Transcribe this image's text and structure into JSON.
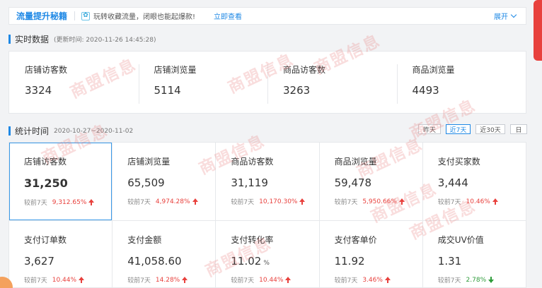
{
  "banner": {
    "title": "流量提升秘籍",
    "icon": "gift-icon",
    "text": "玩转收藏流量，闭眼也能起爆款!",
    "link": "立即查看",
    "expand": "展开"
  },
  "realtime": {
    "title": "实时数据",
    "updated": "(更新时间: 2020-11-26 14:45:28)",
    "items": [
      {
        "label": "店铺访客数",
        "value": "3324"
      },
      {
        "label": "店铺浏览量",
        "value": "5114"
      },
      {
        "label": "商品访客数",
        "value": "3263"
      },
      {
        "label": "商品浏览量",
        "value": "4493"
      }
    ]
  },
  "stats": {
    "title": "统计时间",
    "range": "2020-10-27~2020-11-02",
    "buttons": [
      "昨天",
      "近7天",
      "近30天",
      "日"
    ],
    "active_button": "近7天",
    "cards": [
      {
        "label": "店铺访客数",
        "value": "31,250",
        "unit": "",
        "cmp_label": "较前7天",
        "cmp_value": "9,312.65%",
        "trend": "up"
      },
      {
        "label": "店铺浏览量",
        "value": "65,509",
        "unit": "",
        "cmp_label": "较前7天",
        "cmp_value": "4,974.28%",
        "trend": "up"
      },
      {
        "label": "商品访客数",
        "value": "31,119",
        "unit": "",
        "cmp_label": "较前7天",
        "cmp_value": "10,170.30%",
        "trend": "up"
      },
      {
        "label": "商品浏览量",
        "value": "59,478",
        "unit": "",
        "cmp_label": "较前7天",
        "cmp_value": "5,950.66%",
        "trend": "up"
      },
      {
        "label": "支付买家数",
        "value": "3,444",
        "unit": "",
        "cmp_label": "较前7天",
        "cmp_value": "10.46%",
        "trend": "up"
      },
      {
        "label": "支付订单数",
        "value": "3,627",
        "unit": "",
        "cmp_label": "较前7天",
        "cmp_value": "10.44%",
        "trend": "up"
      },
      {
        "label": "支付金额",
        "value": "41,058.60",
        "unit": "",
        "cmp_label": "较前7天",
        "cmp_value": "14.28%",
        "trend": "up"
      },
      {
        "label": "支付转化率",
        "value": "11.02",
        "unit": "%",
        "cmp_label": "较前7天",
        "cmp_value": "10.44%",
        "trend": "up"
      },
      {
        "label": "支付客单价",
        "value": "11.92",
        "unit": "",
        "cmp_label": "较前7天",
        "cmp_value": "3.46%",
        "trend": "up"
      },
      {
        "label": "成交UV价值",
        "value": "1.31",
        "unit": "",
        "cmp_label": "较前7天",
        "cmp_value": "2.78%",
        "trend": "down"
      }
    ]
  },
  "watermark": "商盟信息",
  "colors": {
    "accent": "#1e88e5",
    "up": "#e8413d",
    "down": "#2e9b3a"
  }
}
